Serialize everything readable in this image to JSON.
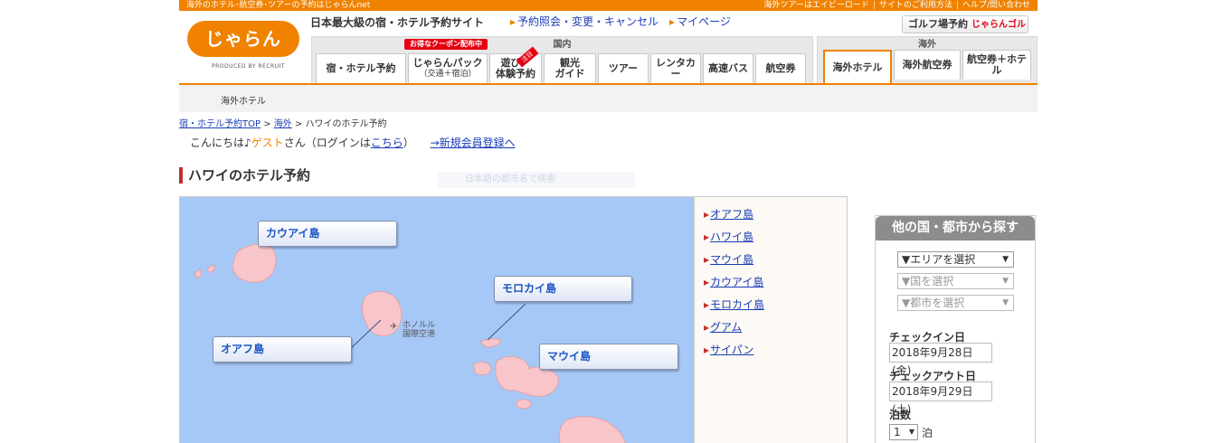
{
  "topbar": {
    "left_text": "海外のホテル･航空券･ツアーの予約はじゃらんnet",
    "right_links": [
      "海外ツアーはエイビーロード",
      "サイトのご利用方法",
      "ヘルプ/問い合わせ"
    ]
  },
  "logo": {
    "text": "じゃらん",
    "sub": "PRODUCED BY RECRUIT"
  },
  "site_tagline": "日本最大級の宿・ホテル予約サイト",
  "top_links": [
    "予約照会・変更・キャンセル",
    "マイページ"
  ],
  "golf": {
    "label": "ゴルフ場予約",
    "brand": "じゃらんゴルフ"
  },
  "nav": {
    "domestic_label": "国内",
    "overseas_label": "海外",
    "coupon_badge": "お得なクーポン配布中",
    "new_badge": "注目",
    "domestic_tabs": [
      {
        "label": "宿・ホテル予約",
        "sub": ""
      },
      {
        "label": "じゃらんパック",
        "sub": "（交通＋宿泊）"
      },
      {
        "label": "遊び・",
        "sub": "体験予約"
      },
      {
        "label": "観光",
        "sub": "ガイド"
      },
      {
        "label": "ツアー",
        "sub": ""
      },
      {
        "label": "レンタカー",
        "sub": ""
      },
      {
        "label": "高速バス",
        "sub": ""
      },
      {
        "label": "航空券",
        "sub": ""
      }
    ],
    "overseas_tabs": [
      {
        "label": "海外ホテル",
        "active": true
      },
      {
        "label": "海外航空券",
        "active": false
      },
      {
        "label": "航空券＋ホテル",
        "active": false
      }
    ]
  },
  "subnav": {
    "label": "海外ホテル"
  },
  "breadcrumb": {
    "items": [
      "宿・ホテル予約TOP",
      "海外",
      "ハワイのホテル予約"
    ],
    "sep": " > "
  },
  "greeting": {
    "prefix": "こんにちは♪",
    "guest": "ゲスト",
    "suffix": "さん（ログインは",
    "login_link": "こちら",
    "close": "）",
    "register_link": "→新規会員登録へ"
  },
  "page_title": "ハワイのホテル予約",
  "ghost_search": "日本語の都市名で検索",
  "map": {
    "islands": [
      "カウアイ島",
      "オアフ島",
      "モロカイ島",
      "マウイ島"
    ],
    "airport_label_line1": "ホノルル",
    "airport_label_line2": "国際空港",
    "colors": {
      "sea": "#a6c8f6",
      "land": "#f8c6ca"
    }
  },
  "island_list": [
    "オアフ島",
    "ハワイ島",
    "マウイ島",
    "カウアイ島",
    "モロカイ島",
    "グアム",
    "サイパン"
  ],
  "search_panel": {
    "title": "他の国・都市から探す",
    "area_select": "▼エリアを選択",
    "country_select": "▼国を選択",
    "city_select": "▼都市を選択",
    "checkin_label": "チェックイン日",
    "checkin_value": "2018年9月28日(金)",
    "checkout_label": "チェックアウト日",
    "checkout_value": "2018年9月29日(土)",
    "nights_label": "泊数",
    "nights_value": "1",
    "nights_unit": "泊"
  },
  "colors": {
    "accent": "#f08200",
    "link": "#1a3cb8",
    "title_bar": "#c0312b"
  }
}
